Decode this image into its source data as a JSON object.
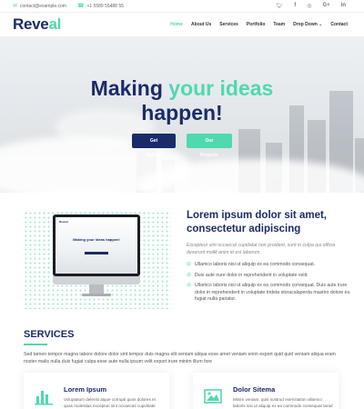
{
  "topbar": {
    "email": "contact@example.com",
    "phone": "+1 5589 55488 55",
    "social_icons": [
      "twitter-icon",
      "facebook-icon",
      "instagram-icon",
      "google-plus-icon",
      "linkedin-icon"
    ]
  },
  "header": {
    "logo_main": "Reve",
    "logo_accent": "al",
    "nav": [
      "Home",
      "About Us",
      "Services",
      "Portfolio",
      "Team",
      "Drop Down",
      "Contact"
    ],
    "active_nav": "Home"
  },
  "hero": {
    "title_pre": "Making ",
    "title_accent": "your ideas",
    "title_post": "happen!",
    "btn_primary": "Get Started",
    "btn_secondary": "Our Projects"
  },
  "about": {
    "title": "Lorem ipsum dolor sit amet, consectetur adipiscing",
    "lead": "Excepteur sint occaecat cupidatat non proident, sunt in culpa qui officia deserunt mollit anim id est laborum.",
    "items": [
      "Ullamco laboris nisi ut aliquip ex ea commodo consequat.",
      "Duis aute irure dolor in reprehenderit in voluptate velit.",
      "Ullamco laboris nisi ut aliquip ex ea commodo consequat. Duis aute irure dolor in reprehenderit in voluptate trideta storacalaperda mastiro dolore eu fugiat nulla pariatur."
    ],
    "mock_logo": "Reveal",
    "mock_title": "Making your ideas happen!"
  },
  "services": {
    "title": "SERVICES",
    "description": "Sed tamen tempor magna labore dolore dolor sint tempor duis magna elit veniam aliqua esse amet veniam enim export quid quid veniam aliqua eram noster malis nulla duis fugiat culpa esse aute nulla ipsum velit export irure minim illum fore",
    "cards": [
      {
        "title": "Lorem Ipsum",
        "text": "Voluptatum deleniti atque corrupti quos dolores et quas molestias excepturi sint occaecati cupiditate",
        "icon": "bar-chart-icon"
      },
      {
        "title": "Dolor Sitema",
        "text": "Minim veniam, quis nostrud exercitation ullamco laboris nisi ut aliquip ex ea commodo consequat tarad",
        "icon": "picture-icon"
      }
    ]
  },
  "colors": {
    "navy": "#1a2b6a",
    "accent": "#50d8af"
  }
}
